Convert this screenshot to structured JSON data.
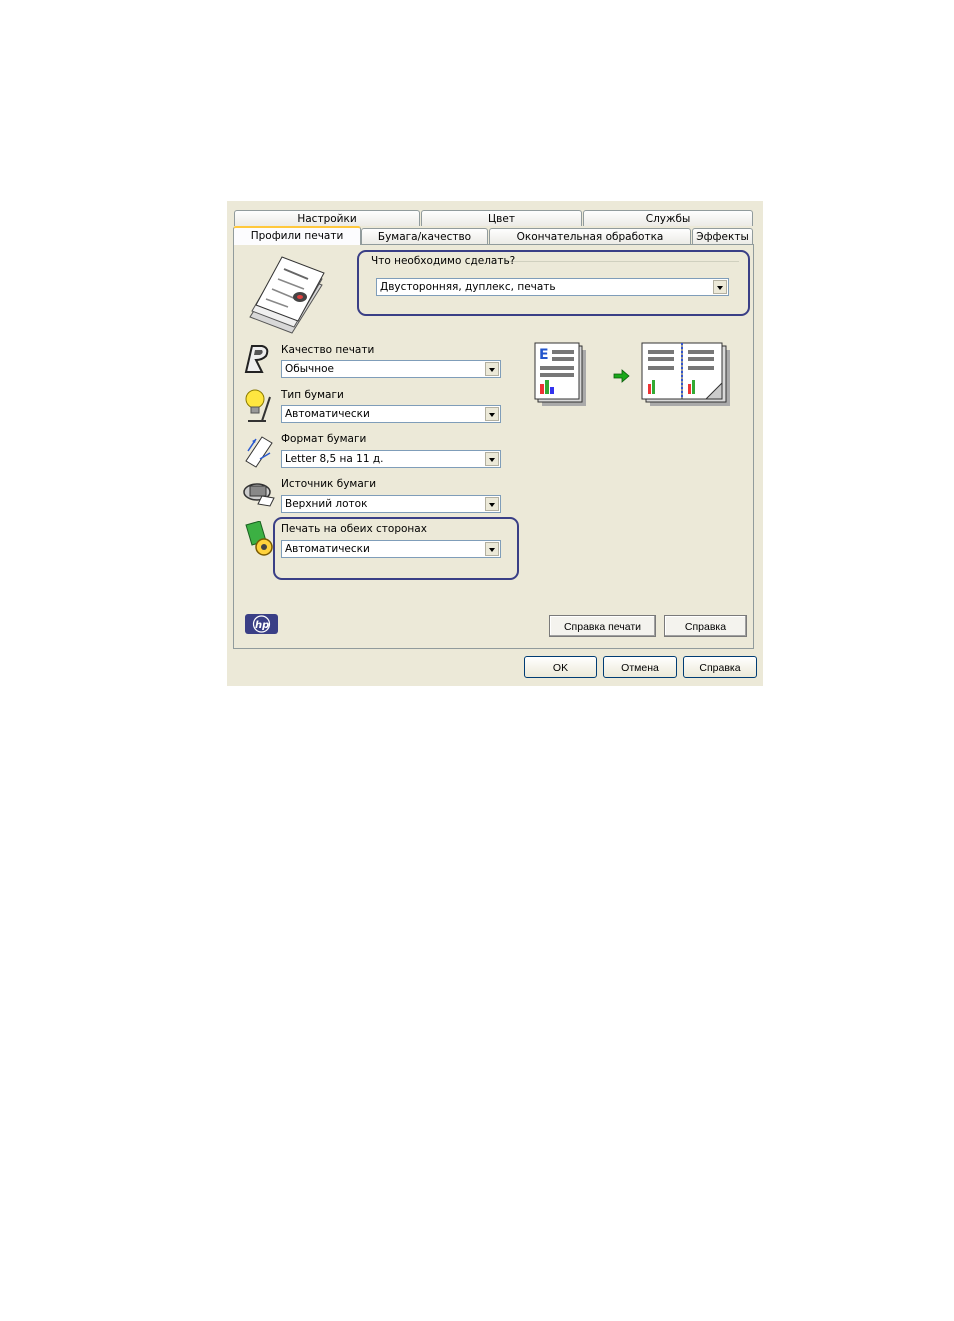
{
  "tabs_row1": [
    "Настройки",
    "Цвет",
    "Службы"
  ],
  "tabs_row2": [
    "Профили печати",
    "Бумага/качество",
    "Окончательная обработка",
    "Эффекты"
  ],
  "task": {
    "label": "Что необходимо сделать?",
    "value": "Двусторонняя, дуплекс, печать"
  },
  "fields": {
    "quality": {
      "label": "Качество печати",
      "value": "Обычное"
    },
    "paper_type": {
      "label": "Тип бумаги",
      "value": "Автоматически"
    },
    "paper_size": {
      "label": "Формат бумаги",
      "value": "Letter 8,5 на 11 д."
    },
    "paper_source": {
      "label": "Источник бумаги",
      "value": "Верхний лоток"
    },
    "duplex": {
      "label": "Печать на обеих сторонах",
      "value": "Автоматически"
    }
  },
  "panel_buttons": {
    "print_help": "Справка печати",
    "help": "Справка"
  },
  "dialog_buttons": {
    "ok": "OK",
    "cancel": "Отмена",
    "help": "Справка"
  },
  "brand": {
    "logo_text": "hp",
    "accent": "#3a3f86"
  }
}
